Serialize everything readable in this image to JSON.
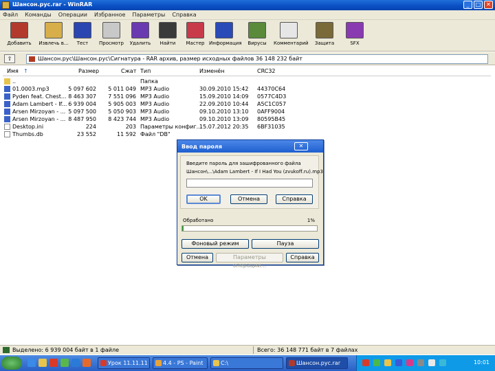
{
  "window": {
    "title": "Шансон.рус.rar - WinRAR",
    "controls": {
      "minimize": "_",
      "maximize": "□",
      "close": "✕"
    }
  },
  "menu": [
    "Файл",
    "Команды",
    "Операции",
    "Избранное",
    "Параметры",
    "Справка"
  ],
  "toolbar": [
    {
      "label": "Добавить",
      "icon": "add-archive-icon",
      "color": "#b23a2c"
    },
    {
      "label": "Извлечь в...",
      "icon": "extract-folder-icon",
      "color": "#d7ae49"
    },
    {
      "label": "Тест",
      "icon": "test-book-icon",
      "color": "#2a46b0"
    },
    {
      "label": "Просмотр",
      "icon": "view-glasses-icon",
      "color": "#c8c8c8"
    },
    {
      "label": "Удалить",
      "icon": "delete-books-icon",
      "color": "#6a3ab0"
    },
    {
      "label": "Найти",
      "icon": "find-binoculars-icon",
      "color": "#3a3a3a"
    },
    {
      "label": "Мастер",
      "icon": "wizard-icon",
      "color": "#c83a4a"
    },
    {
      "label": "Информация",
      "icon": "info-icon",
      "color": "#2a4ab8"
    },
    {
      "label": "Вирусы",
      "icon": "virus-scan-icon",
      "color": "#5a8a3a"
    },
    {
      "label": "Комментарий",
      "icon": "comment-icon",
      "color": "#e6e6e6"
    },
    {
      "label": "Защита",
      "icon": "protect-shield-icon",
      "color": "#7a6a3a"
    },
    {
      "label": "SFX",
      "icon": "sfx-icon",
      "color": "#8a3ab0"
    }
  ],
  "address": {
    "up_label": "⇧",
    "path": "Шансон.рус\\Шансон.рус\\Сигнатура - RAR архив, размер исходных файлов 36 148 232 байт"
  },
  "columns": {
    "name": "Имя",
    "size": "Размер",
    "packed": "Сжат",
    "type": "Тип",
    "modified": "Изменён",
    "crc": "CRC32"
  },
  "files": [
    {
      "name": "..",
      "size": "",
      "packed": "",
      "type": "Папка",
      "modified": "",
      "crc": "",
      "kind": "folder"
    },
    {
      "name": "01.0003.mp3",
      "size": "5 097 602",
      "packed": "5 011 049",
      "type": "MP3 Audio",
      "modified": "30.09.2010 15:42",
      "crc": "44370C64",
      "kind": "audio"
    },
    {
      "name": "Pyden feat. Chest...",
      "size": "8 463 307",
      "packed": "7 551 096",
      "type": "MP3 Audio",
      "modified": "15.09.2010 14:09",
      "crc": "0577C4D3",
      "kind": "audio"
    },
    {
      "name": "Adam Lambert - If...",
      "size": "6 939 004",
      "packed": "5 905 003",
      "type": "MP3 Audio",
      "modified": "22.09.2010 10:44",
      "crc": "A5C1C057",
      "kind": "audio"
    },
    {
      "name": "Arsen Mirzoyan - ...",
      "size": "5 097 500",
      "packed": "5 050 903",
      "type": "MP3 Audio",
      "modified": "09.10.2010 13:10",
      "crc": "0AFF9004",
      "kind": "audio"
    },
    {
      "name": "Arsen Mirzoyan - ...",
      "size": "8 487 950",
      "packed": "8 423 744",
      "type": "MP3 Audio",
      "modified": "09.10.2010 13:09",
      "crc": "80595B45",
      "kind": "audio"
    },
    {
      "name": "Desktop.ini",
      "size": "224",
      "packed": "203",
      "type": "Параметры конфиг...",
      "modified": "15.07.2012 20:35",
      "crc": "6BF31035",
      "kind": "doc"
    },
    {
      "name": "Thumbs.db",
      "size": "23 552",
      "packed": "11 592",
      "type": "Файл \"DB\"",
      "modified": "",
      "crc": "",
      "kind": "doc"
    }
  ],
  "dialog": {
    "title": "Ввод пароля",
    "close": "✕",
    "prompt": "Введите пароль для зашифрованного файла",
    "filename": "Шансон\\...\\Adam Lambert - If I Had You (zvukoff.ru).mp3",
    "password_value": "",
    "ok": "OK",
    "cancel": "Отмена",
    "help": "Справка",
    "processed_label": "Обработано",
    "processed_percent": "1%",
    "progress_fraction": 0.01,
    "background_btn": "Фоновый режим",
    "pause_btn": "Пауза",
    "cancel_btn": "Отмена",
    "mode_btn": "Параметры операции...",
    "help_btn": "Справка"
  },
  "status": {
    "left": "Выделено: 6 939 004 байт в 1 файле",
    "right": "Всего: 36 148 771 байт в 7 файлах"
  },
  "taskbar": {
    "tasks": [
      {
        "label": "Урок 11.11.11",
        "color": "#d83a2a",
        "active": false
      },
      {
        "label": "4.4 - PS - Paint",
        "color": "#e8a43a",
        "active": false
      },
      {
        "label": "C:\\",
        "color": "#e8c44d",
        "active": false
      },
      {
        "label": "Шансон.рус.rar",
        "color": "#b23a2c",
        "active": true
      }
    ],
    "clock": "10:01"
  }
}
